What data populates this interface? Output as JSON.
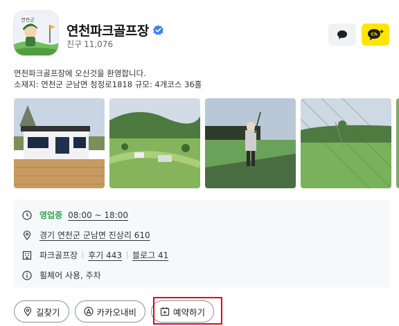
{
  "header": {
    "name": "연천파크골프장",
    "friends_label": "친구",
    "friends_count": "11,076",
    "logo_text": "연천군"
  },
  "intro": {
    "line1": "연천파크골프장에 오신것을 환영합니다.",
    "line2": "소재지: 연천군 군남면 청정로1818 규모: 4개코스 36홀"
  },
  "info": {
    "status": "영업중",
    "hours": "08:00 ~ 18:00",
    "address": "경기 연천군 군남면 진상리 610",
    "category": "파크골프장",
    "reviews": "후기 443",
    "blog": "블로그 41",
    "amenities": "휠체어 사용, 주차"
  },
  "actions": {
    "directions": "길찾기",
    "kakaonavi": "카카오내비",
    "reserve": "예약하기"
  },
  "colors": {
    "accent_yellow": "#fee500",
    "open_green": "#2e9f49",
    "verified_blue": "#3f7ef5",
    "highlight_red": "#e2001a"
  }
}
